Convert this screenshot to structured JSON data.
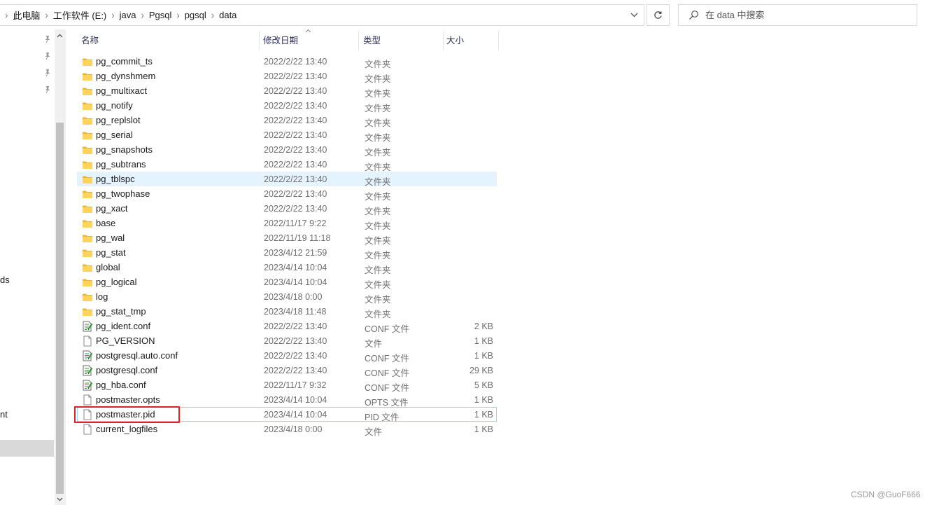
{
  "address_bar": {
    "breadcrumbs": [
      "此电脑",
      "工作软件 (E:)",
      "java",
      "Pgsql",
      "pgsql",
      "data"
    ]
  },
  "search": {
    "placeholder": "在 data 中搜索"
  },
  "nav": {
    "partial_labels": [
      "ds",
      "nt"
    ]
  },
  "columns": {
    "name": "名称",
    "modified": "修改日期",
    "type": "类型",
    "size": "大小"
  },
  "files": [
    {
      "name": "pg_commit_ts",
      "modified": "2022/2/22 13:40",
      "type": "文件夹",
      "size": "",
      "icon": "folder-icon"
    },
    {
      "name": "pg_dynshmem",
      "modified": "2022/2/22 13:40",
      "type": "文件夹",
      "size": "",
      "icon": "folder-icon"
    },
    {
      "name": "pg_multixact",
      "modified": "2022/2/22 13:40",
      "type": "文件夹",
      "size": "",
      "icon": "folder-icon"
    },
    {
      "name": "pg_notify",
      "modified": "2022/2/22 13:40",
      "type": "文件夹",
      "size": "",
      "icon": "folder-icon"
    },
    {
      "name": "pg_replslot",
      "modified": "2022/2/22 13:40",
      "type": "文件夹",
      "size": "",
      "icon": "folder-icon"
    },
    {
      "name": "pg_serial",
      "modified": "2022/2/22 13:40",
      "type": "文件夹",
      "size": "",
      "icon": "folder-icon"
    },
    {
      "name": "pg_snapshots",
      "modified": "2022/2/22 13:40",
      "type": "文件夹",
      "size": "",
      "icon": "folder-icon"
    },
    {
      "name": "pg_subtrans",
      "modified": "2022/2/22 13:40",
      "type": "文件夹",
      "size": "",
      "icon": "folder-icon"
    },
    {
      "name": "pg_tblspc",
      "modified": "2022/2/22 13:40",
      "type": "文件夹",
      "size": "",
      "icon": "folder-icon",
      "state": "hover"
    },
    {
      "name": "pg_twophase",
      "modified": "2022/2/22 13:40",
      "type": "文件夹",
      "size": "",
      "icon": "folder-icon"
    },
    {
      "name": "pg_xact",
      "modified": "2022/2/22 13:40",
      "type": "文件夹",
      "size": "",
      "icon": "folder-icon"
    },
    {
      "name": "base",
      "modified": "2022/11/17 9:22",
      "type": "文件夹",
      "size": "",
      "icon": "folder-icon"
    },
    {
      "name": "pg_wal",
      "modified": "2022/11/19 11:18",
      "type": "文件夹",
      "size": "",
      "icon": "folder-icon"
    },
    {
      "name": "pg_stat",
      "modified": "2023/4/12 21:59",
      "type": "文件夹",
      "size": "",
      "icon": "folder-icon"
    },
    {
      "name": "global",
      "modified": "2023/4/14 10:04",
      "type": "文件夹",
      "size": "",
      "icon": "folder-icon"
    },
    {
      "name": "pg_logical",
      "modified": "2023/4/14 10:04",
      "type": "文件夹",
      "size": "",
      "icon": "folder-icon"
    },
    {
      "name": "log",
      "modified": "2023/4/18 0:00",
      "type": "文件夹",
      "size": "",
      "icon": "folder-icon"
    },
    {
      "name": "pg_stat_tmp",
      "modified": "2023/4/18 11:48",
      "type": "文件夹",
      "size": "",
      "icon": "folder-icon"
    },
    {
      "name": "pg_ident.conf",
      "modified": "2022/2/22 13:40",
      "type": "CONF 文件",
      "size": "2 KB",
      "icon": "config-file-icon"
    },
    {
      "name": "PG_VERSION",
      "modified": "2022/2/22 13:40",
      "type": "文件",
      "size": "1 KB",
      "icon": "file-icon"
    },
    {
      "name": "postgresql.auto.conf",
      "modified": "2022/2/22 13:40",
      "type": "CONF 文件",
      "size": "1 KB",
      "icon": "config-file-icon"
    },
    {
      "name": "postgresql.conf",
      "modified": "2022/2/22 13:40",
      "type": "CONF 文件",
      "size": "29 KB",
      "icon": "config-file-icon"
    },
    {
      "name": "pg_hba.conf",
      "modified": "2022/11/17 9:32",
      "type": "CONF 文件",
      "size": "5 KB",
      "icon": "config-file-icon"
    },
    {
      "name": "postmaster.opts",
      "modified": "2023/4/14 10:04",
      "type": "OPTS 文件",
      "size": "1 KB",
      "icon": "file-icon"
    },
    {
      "name": "postmaster.pid",
      "modified": "2023/4/14 10:04",
      "type": "PID 文件",
      "size": "1 KB",
      "icon": "file-icon",
      "state": "selected",
      "highlighted": true
    },
    {
      "name": "current_logfiles",
      "modified": "2023/4/18 0:00",
      "type": "文件",
      "size": "1 KB",
      "icon": "file-icon"
    }
  ],
  "watermark": "CSDN @GuoF666",
  "colors": {
    "folder": "#ffd35c",
    "hover": "#e5f3ff",
    "selected_border": "#99d1ff",
    "highlight_box": "#e0212a"
  }
}
